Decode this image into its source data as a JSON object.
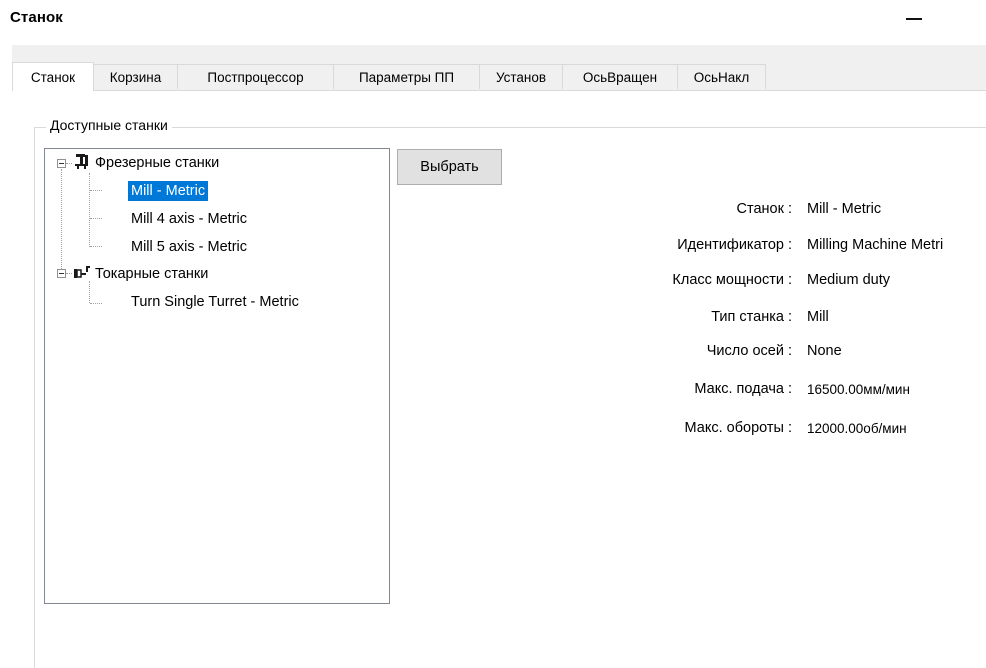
{
  "window": {
    "title": "Станок",
    "minimize_glyph": "—"
  },
  "tabs": [
    {
      "label": "Станок",
      "active": true
    },
    {
      "label": "Корзина",
      "active": false
    },
    {
      "label": "Постпроцессор",
      "active": false
    },
    {
      "label": "Параметры ПП",
      "active": false
    },
    {
      "label": "Установ",
      "active": false
    },
    {
      "label": "ОсьВращен",
      "active": false
    },
    {
      "label": "ОсьНакл",
      "active": false
    }
  ],
  "group": {
    "label": "Доступные станки"
  },
  "tree": {
    "groups": [
      {
        "label": "Фрезерные станки",
        "icon": "milling-machine-icon",
        "expanded": true,
        "items": [
          {
            "label": "Mill - Metric",
            "selected": true
          },
          {
            "label": "Mill 4 axis - Metric",
            "selected": false
          },
          {
            "label": "Mill 5 axis - Metric",
            "selected": false
          }
        ]
      },
      {
        "label": "Токарные станки",
        "icon": "lathe-machine-icon",
        "expanded": true,
        "items": [
          {
            "label": "Turn Single Turret - Metric",
            "selected": false
          }
        ]
      }
    ]
  },
  "select_button": {
    "label": "Выбрать"
  },
  "info": [
    {
      "label": "Станок :",
      "value": "Mill - Metric"
    },
    {
      "label": "Идентификатор :",
      "value": "Milling Machine Metri"
    },
    {
      "label": "Класс мощности :",
      "value": "Medium duty"
    },
    {
      "label": "Тип станка :",
      "value": "Mill"
    },
    {
      "label": "Число осей :",
      "value": "None"
    },
    {
      "label": "Макс. подача :",
      "value": "16500.00мм/мин"
    },
    {
      "label": "Макс. обороты :",
      "value": "12000.00об/мин"
    }
  ],
  "colors": {
    "selection": "#0078d7",
    "tab_background": "#f0f0f0",
    "button_background": "#e1e1e1"
  }
}
